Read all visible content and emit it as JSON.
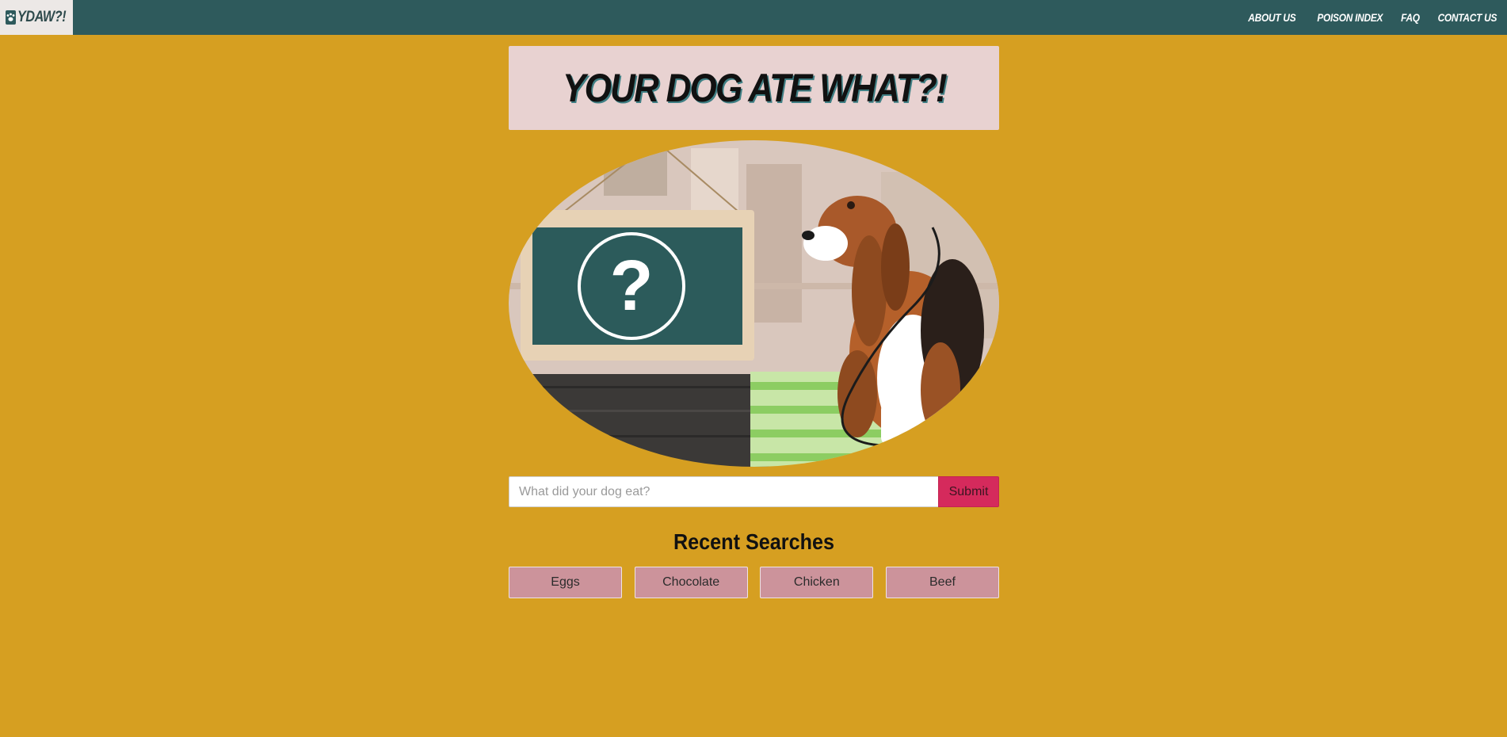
{
  "nav": {
    "brand": "YDAW?!",
    "links": [
      "ABOUT US",
      "POISON INDEX",
      "FAQ",
      "CONTACT US"
    ]
  },
  "hero": {
    "title": "YOUR DOG ATE WHAT?!"
  },
  "search": {
    "placeholder": "What did your dog eat?",
    "value": "",
    "submit_label": "Submit"
  },
  "recent": {
    "heading": "Recent Searches",
    "items": [
      "Eggs",
      "Chocolate",
      "Chicken",
      "Beef"
    ]
  },
  "colors": {
    "background": "#d69f21",
    "navbar": "#2e5a5c",
    "title_box": "#e8d2d1",
    "submit": "#d52a5c",
    "recent_button": "#cc939b"
  },
  "icons": {
    "logo": "paw-icon"
  }
}
